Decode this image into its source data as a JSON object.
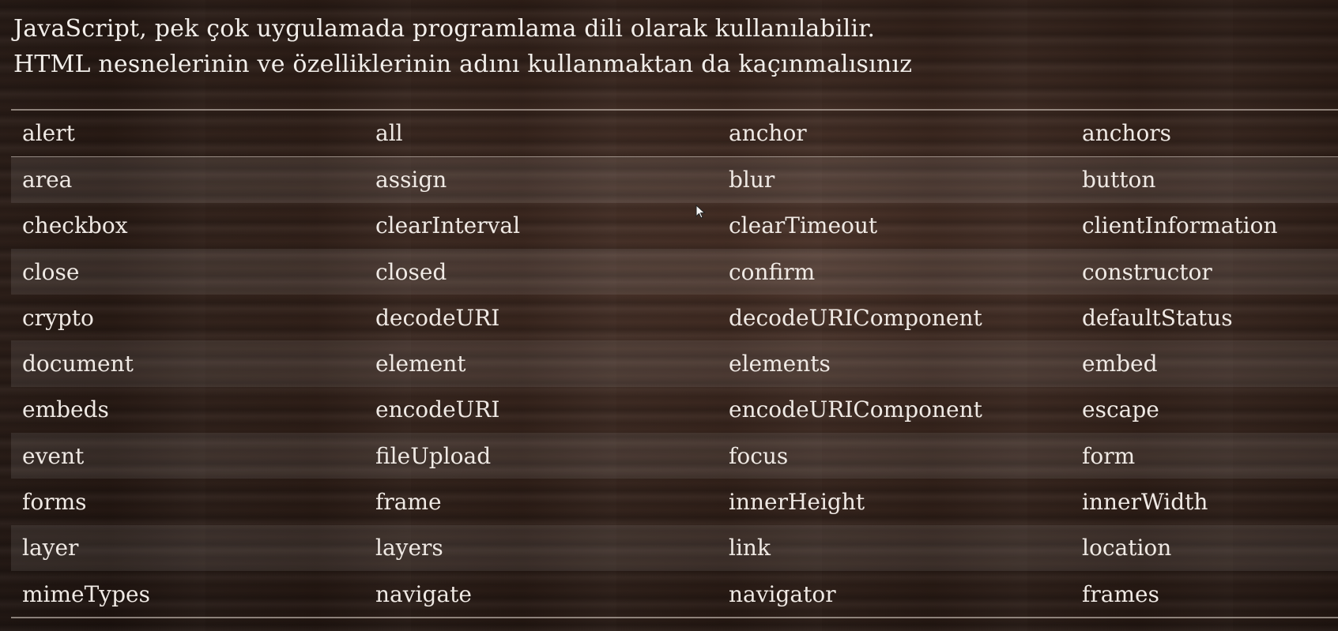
{
  "slide": {
    "title_line1": "JavaScript, pek çok uygulamada programlama dili olarak kullanılabilir.",
    "title_line2": "HTML nesnelerinin ve özelliklerinin adını kullanmaktan da kaçınmalısınız"
  },
  "table": {
    "rows": [
      [
        "alert",
        "all",
        "anchor",
        "anchors"
      ],
      [
        "area",
        "assign",
        "blur",
        "button"
      ],
      [
        "checkbox",
        "clearInterval",
        "clearTimeout",
        "clientInformation"
      ],
      [
        "close",
        "closed",
        "confirm",
        "constructor"
      ],
      [
        "crypto",
        "decodeURI",
        "decodeURIComponent",
        "defaultStatus"
      ],
      [
        "document",
        "element",
        "elements",
        "embed"
      ],
      [
        "embeds",
        "encodeURI",
        "encodeURIComponent",
        "escape"
      ],
      [
        "event",
        "fileUpload",
        "focus",
        "form"
      ],
      [
        "forms",
        "frame",
        "innerHeight",
        "innerWidth"
      ],
      [
        "layer",
        "layers",
        "link",
        "location"
      ],
      [
        "mimeTypes",
        "navigate",
        "navigator",
        "frames"
      ]
    ]
  },
  "cursor": {
    "icon": "mouse-pointer-icon"
  }
}
